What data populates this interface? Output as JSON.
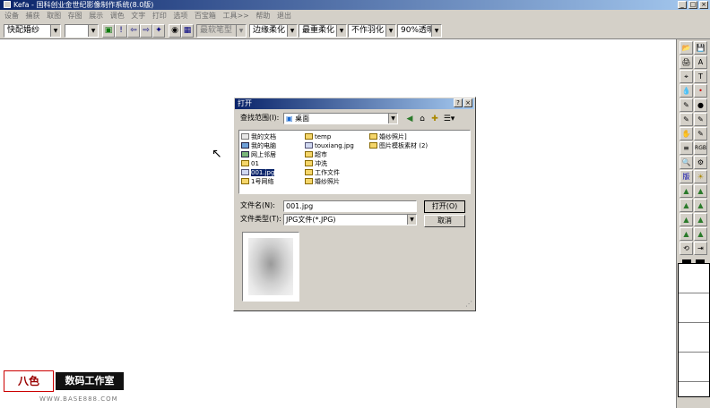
{
  "window": {
    "title": "Kefa - 国科创业金世纪影像制作系统(8.0版)",
    "minimize": "_",
    "maximize": "□",
    "close": "×"
  },
  "menu": [
    "设备",
    "捕获",
    "取图",
    "存图",
    "展示",
    "调色",
    "文字",
    "打印",
    "选项",
    "百宝箱",
    "工具>>",
    "帮助",
    "退出"
  ],
  "toolbar": {
    "template_combo": "快配婚纱",
    "empty_combo": "",
    "brush_combo": "最软笔型",
    "edge_combo": "边缘柔化",
    "heavy_combo": "最重柔化",
    "feather_combo": "不作羽化",
    "opacity_combo": "90%透明",
    "icons": [
      "image-icon",
      "exclamation-icon",
      "arrow-left-icon",
      "arrow-right-icon",
      "magic-wand-icon",
      "eye-icon",
      "grid-icon"
    ]
  },
  "toolbox": {
    "tools": [
      "📂",
      "💾",
      "🖨",
      "A",
      "⌖",
      "T",
      "💧",
      "•",
      "✎",
      "●",
      "✎",
      "✎",
      "✋",
      "✎",
      "≡",
      "RGB",
      "🔍",
      "⚙",
      "版",
      "☀",
      "▲",
      "▲",
      "▲",
      "▲",
      "▲",
      "▲",
      "▲",
      "▲",
      "⟲",
      "⇥"
    ]
  },
  "dialog": {
    "title": "打开",
    "help_btn": "?",
    "close_btn": "×",
    "lookin_label": "查找范围(I):",
    "lookin_value": "桌面",
    "files_col1": [
      {
        "name": "我的文档",
        "kind": "doc"
      },
      {
        "name": "我的电脑",
        "kind": "pc"
      },
      {
        "name": "网上邻居",
        "kind": "net"
      },
      {
        "name": "01",
        "kind": "folder"
      },
      {
        "name": "001.jpg",
        "kind": "img",
        "selected": true
      },
      {
        "name": "1号网络",
        "kind": "folder"
      }
    ],
    "files_col2": [
      {
        "name": "temp",
        "kind": "folder"
      },
      {
        "name": "touxiang.jpg",
        "kind": "img"
      },
      {
        "name": "超市",
        "kind": "folder"
      },
      {
        "name": "冲洗",
        "kind": "folder"
      },
      {
        "name": "工作文件",
        "kind": "folder"
      },
      {
        "name": "婚纱照片",
        "kind": "folder"
      }
    ],
    "files_col3": [
      {
        "name": "婚纱照片]",
        "kind": "folder"
      },
      {
        "name": "图片模板素材 (2)",
        "kind": "folder"
      }
    ],
    "filename_label": "文件名(N):",
    "filename_value": "001.jpg",
    "filetype_label": "文件类型(T):",
    "filetype_value": "JPG文件(*.JPG)",
    "open_btn": "打开(O)",
    "cancel_btn": "取消"
  },
  "watermark": {
    "left": "八色",
    "right": "数码工作室",
    "url": "WWW.BASE888.COM"
  }
}
